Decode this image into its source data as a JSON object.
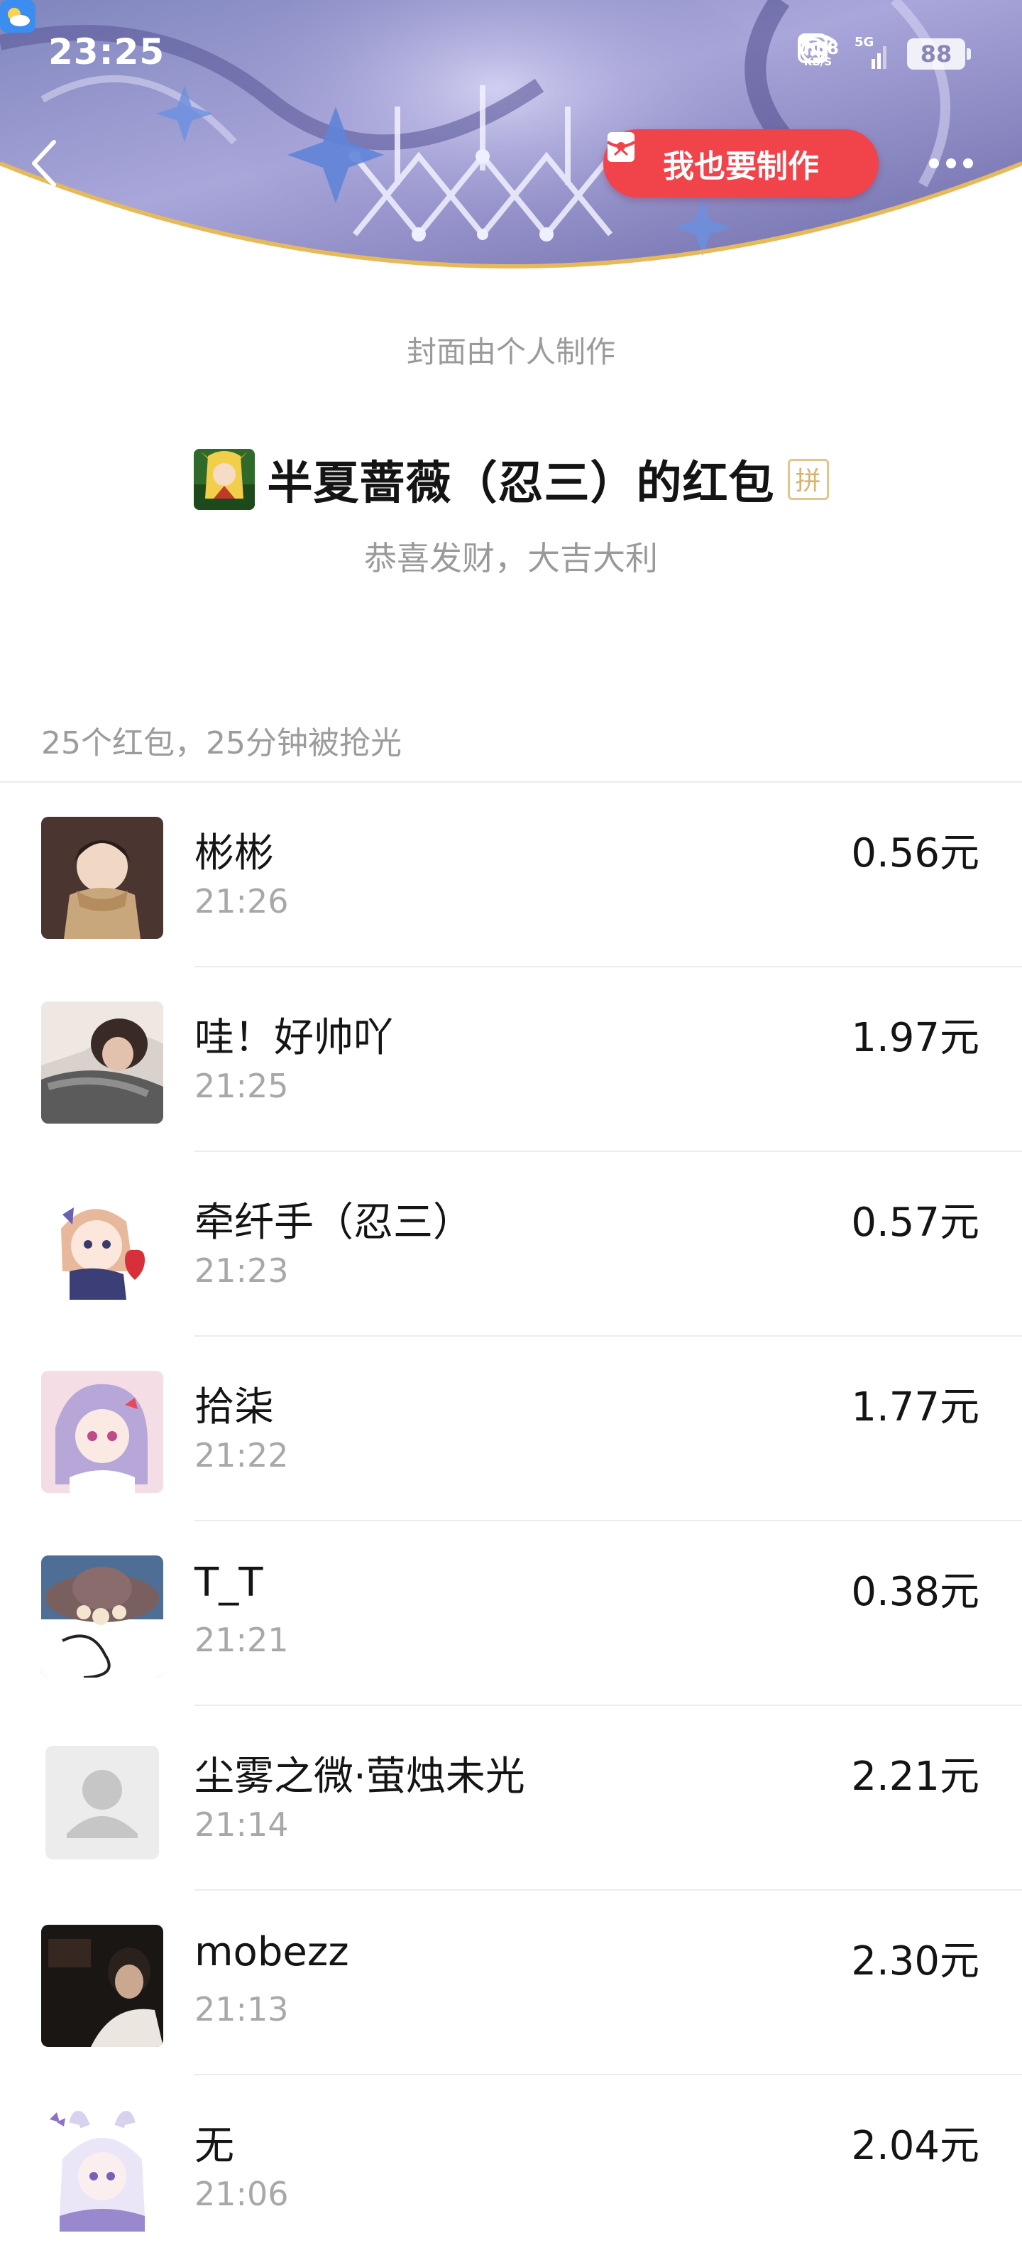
{
  "status_bar": {
    "time": "23:25",
    "net_speed_value": "0.58",
    "net_speed_unit": "KB/S",
    "signal_label": "5G",
    "battery": "88"
  },
  "header": {
    "make_button_label": "我也要制作",
    "cover_note": "封面由个人制作",
    "sender_title": "半夏蔷薇（忍三）的红包",
    "pin_badge": "拼",
    "wish": "恭喜发财，大吉大利"
  },
  "summary": "25个红包，25分钟被抢光",
  "records": [
    {
      "name": "彬彬",
      "time": "21:26",
      "amount": "0.56元",
      "avatar": "anime-boy-scarf-avatar"
    },
    {
      "name": "哇！好帅吖",
      "time": "21:25",
      "amount": "1.97元",
      "avatar": "photo-girl-avatar"
    },
    {
      "name": "牵纤手（忍三）",
      "time": "21:23",
      "amount": "0.57元",
      "avatar": "chibi-heart-avatar"
    },
    {
      "name": "拾柒",
      "time": "21:22",
      "amount": "1.77元",
      "avatar": "anime-purple-hair-avatar"
    },
    {
      "name": "T_T",
      "time": "21:21",
      "amount": "0.38元",
      "avatar": "hat-flower-avatar"
    },
    {
      "name": "尘雾之微·萤烛未光",
      "time": "21:14",
      "amount": "2.21元",
      "avatar": "default-user-avatar"
    },
    {
      "name": "mobezz",
      "time": "21:13",
      "amount": "2.30元",
      "avatar": "car-night-photo-avatar"
    },
    {
      "name": "无",
      "time": "21:06",
      "amount": "2.04元",
      "avatar": "chibi-bunny-hood-avatar"
    }
  ],
  "colors": {
    "accent_red": "#f0434a",
    "banner_purple": "#8f8cc4",
    "gold_curve": "#e6b95a",
    "secondary_text": "#a8a8a8"
  }
}
